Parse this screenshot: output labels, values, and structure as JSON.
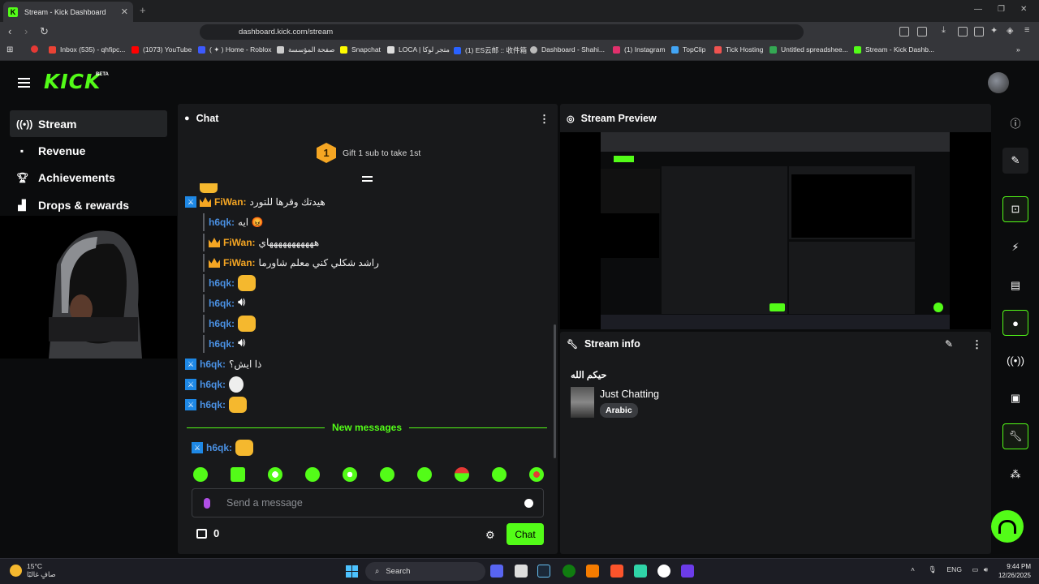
{
  "browser": {
    "tab_title": "Stream - Kick Dashboard",
    "tab_favicon": "K",
    "url": "dashboard.kick.com/stream",
    "bookmarks": [
      "Inbox (535) - qhfipc...",
      "(1073) YouTube",
      "( ✦ ) Home - Roblox",
      "صفحة المؤسسة",
      "Snapchat",
      "LOCA | متجر لوكا",
      "(1) ES云邮 :: 收件箱",
      "Dashboard - Shahi...",
      "(1) Instagram",
      "TopClip",
      "Tick Hosting",
      "Untitled spreadshee...",
      "Stream - Kick Dashb..."
    ]
  },
  "app": {
    "logo": "KICK",
    "beta": "BETA",
    "nav": [
      {
        "label": "Stream",
        "icon": "stream-icon",
        "active": true
      },
      {
        "label": "Revenue",
        "icon": "revenue-icon"
      },
      {
        "label": "Achievements",
        "icon": "trophy-icon"
      },
      {
        "label": "Drops & rewards",
        "icon": "drops-icon"
      }
    ]
  },
  "chat": {
    "title": "Chat",
    "gift_count": "1",
    "gift_text": "Gift 1 sub to take 1st",
    "messages": [
      {
        "user": "FiWan",
        "color": "#f5a623",
        "badges": [
          "mod",
          "crown"
        ],
        "text": "هيدتك وقرها للتورد",
        "reply": false
      },
      {
        "user": "h6qk",
        "color": "#4a90e2",
        "badges": [],
        "text": "ايه 😡",
        "reply": true
      },
      {
        "user": "FiWan",
        "color": "#f5a623",
        "badges": [
          "crown"
        ],
        "text": "هههههههههههاي",
        "reply": true
      },
      {
        "user": "FiWan",
        "color": "#f5a623",
        "badges": [
          "crown"
        ],
        "text": "راشد شكلي كني معلم شاورما",
        "reply": true
      },
      {
        "user": "h6qk",
        "color": "#4a90e2",
        "badges": [],
        "emote": "cat",
        "reply": true
      },
      {
        "user": "h6qk",
        "color": "#4a90e2",
        "badges": [],
        "emote": "speaker",
        "reply": true
      },
      {
        "user": "h6qk",
        "color": "#4a90e2",
        "badges": [],
        "emote": "cat",
        "reply": true
      },
      {
        "user": "h6qk",
        "color": "#4a90e2",
        "badges": [],
        "emote": "speaker",
        "reply": true
      },
      {
        "user": "h6qk",
        "color": "#4a90e2",
        "badges": [
          "mod"
        ],
        "text": "ذا ايش؟",
        "reply": false
      },
      {
        "user": "h6qk",
        "color": "#4a90e2",
        "badges": [
          "mod"
        ],
        "emote": "duck",
        "reply": false
      },
      {
        "user": "h6qk",
        "color": "#4a90e2",
        "badges": [
          "mod"
        ],
        "emote": "cat",
        "reply": false
      }
    ],
    "new_messages": "New messages",
    "new_message": {
      "user": "h6qk",
      "color": "#4a90e2",
      "badges": [
        "mod"
      ],
      "emote": "cat"
    },
    "placeholder": "Send a message",
    "sub_count": "0",
    "send_label": "Chat"
  },
  "preview": {
    "title": "Stream Preview"
  },
  "info": {
    "title": "Stream info",
    "stream_title": "حيكم الله",
    "category": "Just Chatting",
    "language": "Arabic"
  },
  "taskbar": {
    "temp": "15°C",
    "weather": "صافٍ غالبًا",
    "search": "Search",
    "lang": "ENG",
    "time": "9:44 PM",
    "date": "12/26/2025"
  },
  "colors": {
    "accent": "#53fc18",
    "panel": "#18191b",
    "bg": "#0b0c0d"
  }
}
